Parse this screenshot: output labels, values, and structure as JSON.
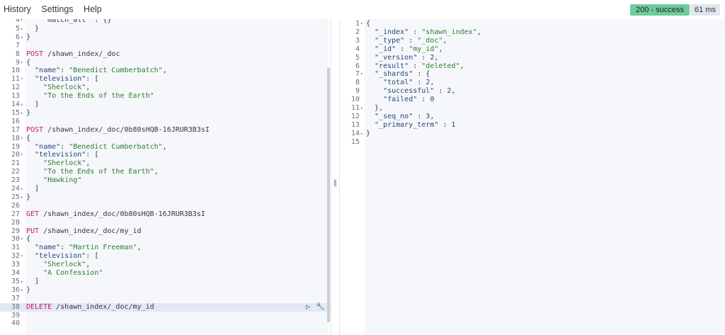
{
  "menu": {
    "history": "History",
    "settings": "Settings",
    "help": "Help"
  },
  "status": {
    "label": "200 - success",
    "time": "61 ms"
  },
  "left_lines": [
    {
      "n": "4",
      "f": "▾",
      "c": "    \"match_all\" : {}"
    },
    {
      "n": "5",
      "f": "▴",
      "c": "  }"
    },
    {
      "n": "6",
      "f": "▴",
      "c": "}"
    },
    {
      "n": "7",
      "f": "",
      "c": ""
    },
    {
      "n": "8",
      "f": "",
      "m": "POST",
      "u": " /shawn_index/_doc"
    },
    {
      "n": "9",
      "f": "▾",
      "c": "{"
    },
    {
      "n": "10",
      "f": "",
      "k": "  \"name\"",
      "p": ": ",
      "s": "\"Benedict Cumberbatch\"",
      "e": ","
    },
    {
      "n": "11",
      "f": "▾",
      "k": "  \"television\"",
      "p": ": ["
    },
    {
      "n": "12",
      "f": "",
      "s": "    \"Sherlock\"",
      "e": ","
    },
    {
      "n": "13",
      "f": "",
      "s": "    \"To the Ends of the Earth\""
    },
    {
      "n": "14",
      "f": "▴",
      "c": "  ]"
    },
    {
      "n": "15",
      "f": "▴",
      "c": "}"
    },
    {
      "n": "16",
      "f": "",
      "c": ""
    },
    {
      "n": "17",
      "f": "",
      "m": "POST",
      "u": " /shawn_index/_doc/0b80sHQB-16JRUR3B3sI"
    },
    {
      "n": "18",
      "f": "▾",
      "c": "{"
    },
    {
      "n": "19",
      "f": "",
      "k": "  \"name\"",
      "p": ": ",
      "s": "\"Benedict Cumberbatch\"",
      "e": ","
    },
    {
      "n": "20",
      "f": "▾",
      "k": "  \"television\"",
      "p": ": ["
    },
    {
      "n": "21",
      "f": "",
      "s": "    \"Sherlock\"",
      "e": ","
    },
    {
      "n": "22",
      "f": "",
      "s": "    \"To the Ends of the Earth\"",
      "e": ","
    },
    {
      "n": "23",
      "f": "",
      "s": "    \"Hawking\""
    },
    {
      "n": "24",
      "f": "▴",
      "c": "  ]"
    },
    {
      "n": "25",
      "f": "▴",
      "c": "}"
    },
    {
      "n": "26",
      "f": "",
      "c": ""
    },
    {
      "n": "27",
      "f": "",
      "m": "GET",
      "u": " /shawn_index/_doc/0b80sHQB-16JRUR3B3sI"
    },
    {
      "n": "28",
      "f": "",
      "c": ""
    },
    {
      "n": "29",
      "f": "",
      "m": "PUT",
      "u": " /shawn_index/_doc/my_id"
    },
    {
      "n": "30",
      "f": "▾",
      "c": "{"
    },
    {
      "n": "31",
      "f": "",
      "k": "  \"name\"",
      "p": ": ",
      "s": "\"Martin Freeman\"",
      "e": ","
    },
    {
      "n": "32",
      "f": "▾",
      "k": "  \"television\"",
      "p": ": ["
    },
    {
      "n": "33",
      "f": "",
      "s": "    \"Sherlock\"",
      "e": ","
    },
    {
      "n": "34",
      "f": "",
      "s": "    \"A Confession\""
    },
    {
      "n": "35",
      "f": "▴",
      "c": "  ]"
    },
    {
      "n": "36",
      "f": "▴",
      "c": "}"
    },
    {
      "n": "37",
      "f": "",
      "c": ""
    },
    {
      "n": "38",
      "f": "",
      "m": "DELETE",
      "u": " /shawn_index/_doc/my_id",
      "active": true
    },
    {
      "n": "39",
      "f": "",
      "c": ""
    },
    {
      "n": "40",
      "f": "",
      "c": ""
    }
  ],
  "right_lines": [
    {
      "n": "1",
      "f": "▾",
      "c": "{"
    },
    {
      "n": "2",
      "f": "",
      "k": "  \"_index\"",
      "p": " : ",
      "s": "\"shawn_index\"",
      "e": ","
    },
    {
      "n": "3",
      "f": "",
      "k": "  \"_type\"",
      "p": " : ",
      "s": "\"_doc\"",
      "e": ","
    },
    {
      "n": "4",
      "f": "",
      "k": "  \"_id\"",
      "p": " : ",
      "s": "\"my_id\"",
      "e": ","
    },
    {
      "n": "5",
      "f": "",
      "k": "  \"_version\"",
      "p": " : ",
      "v": "2",
      "e": ","
    },
    {
      "n": "6",
      "f": "",
      "k": "  \"result\"",
      "p": " : ",
      "s": "\"deleted\"",
      "e": ","
    },
    {
      "n": "7",
      "f": "▾",
      "k": "  \"_shards\"",
      "p": " : {"
    },
    {
      "n": "8",
      "f": "",
      "k": "    \"total\"",
      "p": " : ",
      "v": "2",
      "e": ","
    },
    {
      "n": "9",
      "f": "",
      "k": "    \"successful\"",
      "p": " : ",
      "v": "2",
      "e": ","
    },
    {
      "n": "10",
      "f": "",
      "k": "    \"failed\"",
      "p": " : ",
      "v": "0"
    },
    {
      "n": "11",
      "f": "▴",
      "c": "  },"
    },
    {
      "n": "12",
      "f": "",
      "k": "  \"_seq_no\"",
      "p": " : ",
      "v": "3",
      "e": ","
    },
    {
      "n": "13",
      "f": "",
      "k": "  \"_primary_term\"",
      "p": " : ",
      "v": "1"
    },
    {
      "n": "14",
      "f": "▴",
      "c": "}"
    },
    {
      "n": "15",
      "f": "",
      "c": ""
    }
  ]
}
